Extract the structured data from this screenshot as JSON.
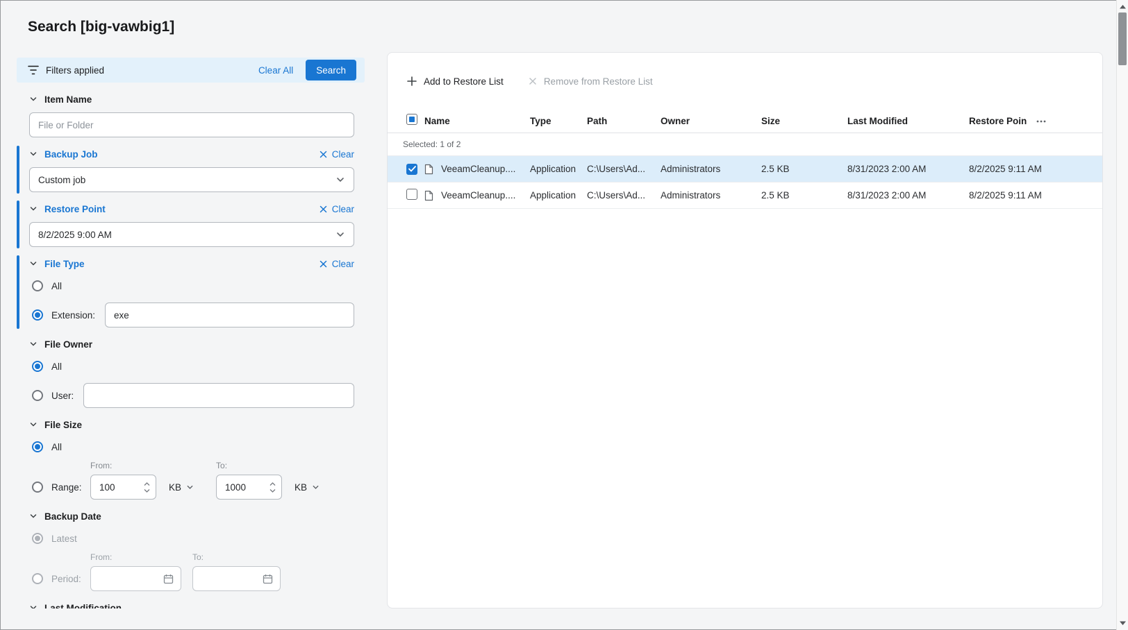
{
  "page": {
    "title": "Search [big-vawbig1]"
  },
  "filters": {
    "header": {
      "title": "Filters applied",
      "clear_all": "Clear All",
      "search": "Search"
    },
    "item_name": {
      "label": "Item Name",
      "placeholder": "File or Folder"
    },
    "backup_job": {
      "label": "Backup Job",
      "clear": "Clear",
      "value": "Custom job"
    },
    "restore_point": {
      "label": "Restore Point",
      "clear": "Clear",
      "value": "8/2/2025 9:00 AM"
    },
    "file_type": {
      "label": "File Type",
      "clear": "Clear",
      "all": "All",
      "extension": "Extension:",
      "extension_value": "exe"
    },
    "file_owner": {
      "label": "File Owner",
      "all": "All",
      "user": "User:",
      "user_value": ""
    },
    "file_size": {
      "label": "File Size",
      "all": "All",
      "range": "Range:",
      "from": "From:",
      "to": "To:",
      "from_value": "100",
      "to_value": "1000",
      "from_unit": "KB",
      "to_unit": "KB"
    },
    "backup_date": {
      "label": "Backup Date",
      "latest": "Latest",
      "period": "Period:",
      "from": "From:",
      "to": "To:",
      "from_value": "",
      "to_value": ""
    },
    "last_modification": {
      "label": "Last Modification"
    }
  },
  "toolbar": {
    "add": "Add to Restore List",
    "remove": "Remove from Restore List"
  },
  "table": {
    "columns": {
      "name": "Name",
      "type": "Type",
      "path": "Path",
      "owner": "Owner",
      "size": "Size",
      "last_modified": "Last Modified",
      "restore_point": "Restore Poin"
    },
    "selected_summary": "Selected: 1 of 2",
    "rows": [
      {
        "name": "VeeamCleanup....",
        "type": "Application",
        "path": "C:\\Users\\Ad...",
        "owner": "Administrators",
        "size": "2.5 KB",
        "last_modified": "8/31/2023 2:00 AM",
        "restore_point": "8/2/2025 9:11 AM",
        "checked": true,
        "selected": true
      },
      {
        "name": "VeeamCleanup....",
        "type": "Application",
        "path": "C:\\Users\\Ad...",
        "owner": "Administrators",
        "size": "2.5 KB",
        "last_modified": "8/31/2023 2:00 AM",
        "restore_point": "8/2/2025 9:11 AM",
        "checked": false,
        "selected": false
      }
    ]
  },
  "colors": {
    "accent": "#1976d2",
    "filters_header_bg": "#e3f1fb",
    "selected_row_bg": "#dcedfa",
    "page_bg": "#f4f5f6"
  }
}
